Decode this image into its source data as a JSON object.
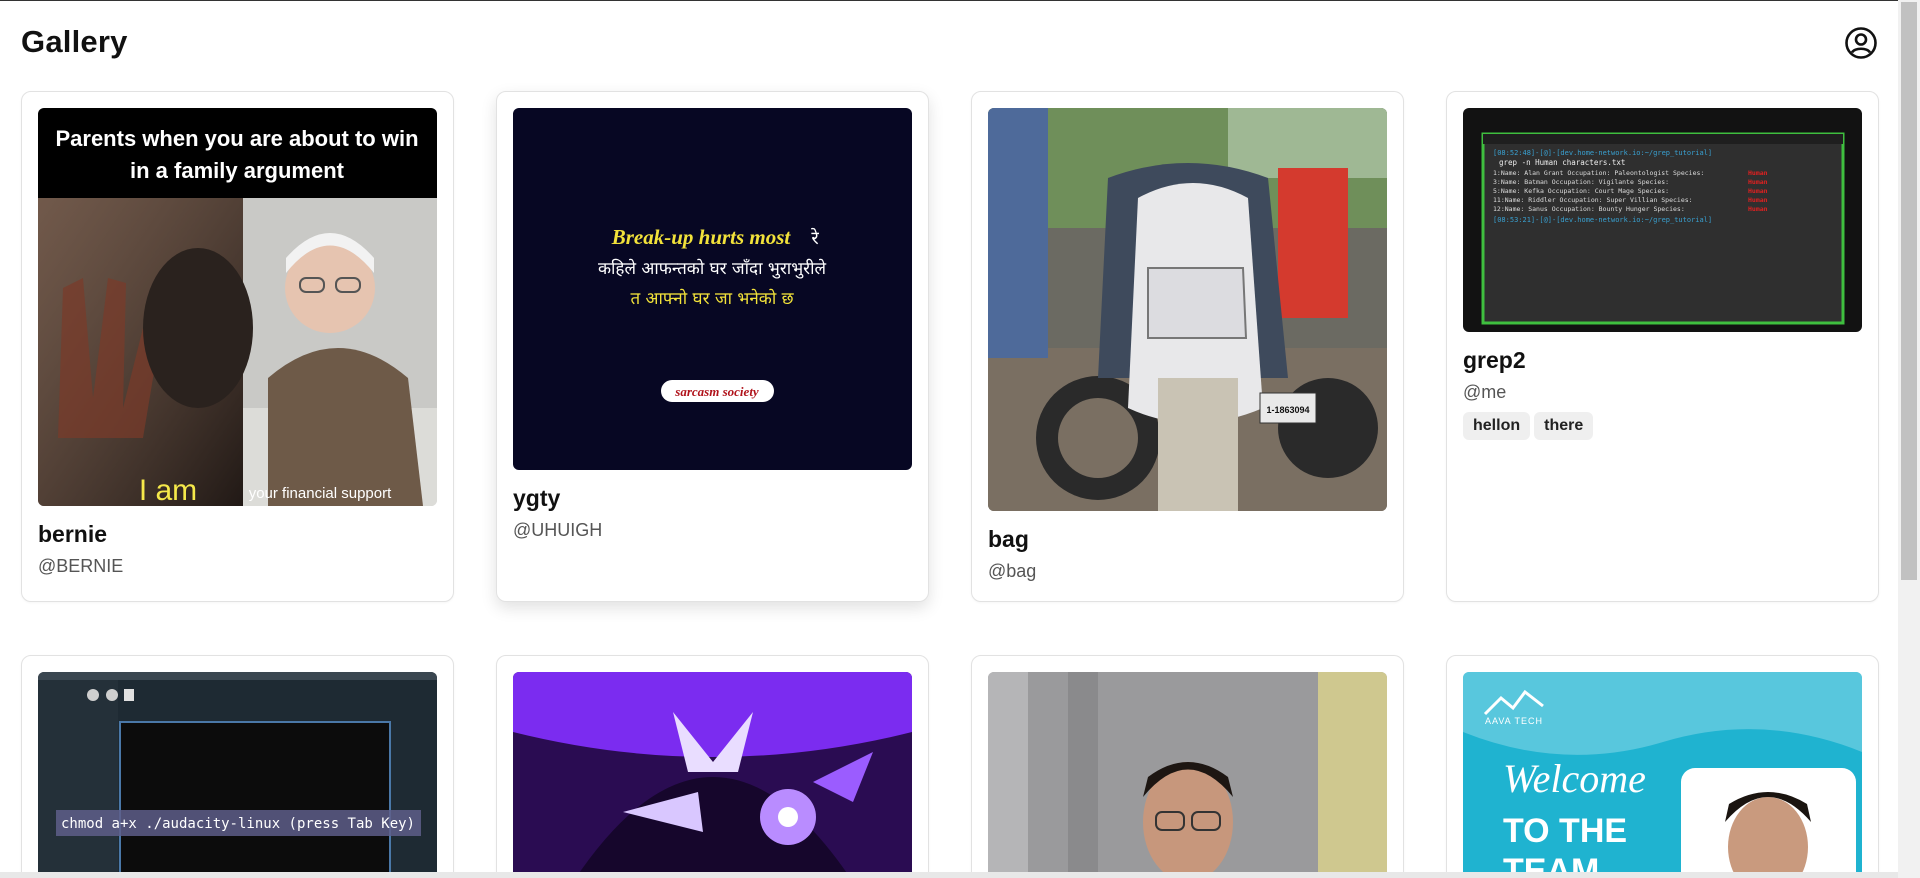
{
  "header": {
    "title": "Gallery",
    "profile_icon": "user-circle-icon"
  },
  "cards": [
    {
      "title": "bernie",
      "user": "@BERNIE",
      "tags": [],
      "image_text": {
        "top": "Parents when you are about to win",
        "top2": "in a family argument",
        "bottom_left": "I am",
        "bottom_right": "your financial support"
      }
    },
    {
      "title": "ygty",
      "user": "@UHUIGH",
      "tags": [],
      "image_text": {
        "line1": "Break-up hurts most",
        "line1b": "रे",
        "line2": "कहिले आफन्तको घर जाँदा भुराभुरीले",
        "line3": "त आफ्नो घर जा भनेको छ",
        "badge": "sarcasm society"
      }
    },
    {
      "title": "bag",
      "user": "@bag",
      "tags": [],
      "image_text": {
        "plate": "1-1863094"
      }
    },
    {
      "title": "grep2",
      "user": "@me",
      "tags": [
        "hellon",
        "there"
      ],
      "image_text": {
        "prompt1": "[08:52:48]-[@]-[dev.home-network.io:~/grep_tutorial]",
        "cmd": "grep -n Human characters.txt",
        "rows": [
          "1:Name: Alan Grant      Occupation: Paleontologist   Species:",
          "3:Name: Batman          Occupation: Vigilante        Species:",
          "5:Name: Kefka           Occupation: Court Mage       Species:",
          "11:Name: Riddler        Occupation: Super Villian    Species:",
          "12:Name: Sanus          Occupation: Bounty Hunger    Species:"
        ],
        "species": "Human",
        "prompt2": "[08:53:21]-[@]-[dev.home-network.io:~/grep_tutorial]"
      }
    },
    {
      "title": "",
      "user": "",
      "tags": [],
      "image_text": {
        "overlay": "chmod a+x ./audacity-linux (press Tab Key)"
      }
    },
    {
      "title": "",
      "user": "",
      "tags": [],
      "image_text": {}
    },
    {
      "title": "",
      "user": "",
      "tags": [],
      "image_text": {}
    },
    {
      "title": "",
      "user": "",
      "tags": [],
      "image_text": {
        "brand": "AAVA TECH",
        "welcome": "Welcome",
        "to_the": "TO THE",
        "team": "TEAM"
      }
    }
  ],
  "colors": {
    "meme_yellow": "#f5e84a",
    "terminal_green": "#3fbf3f",
    "species_red": "#e02020",
    "purple": "#7b2cf0"
  }
}
